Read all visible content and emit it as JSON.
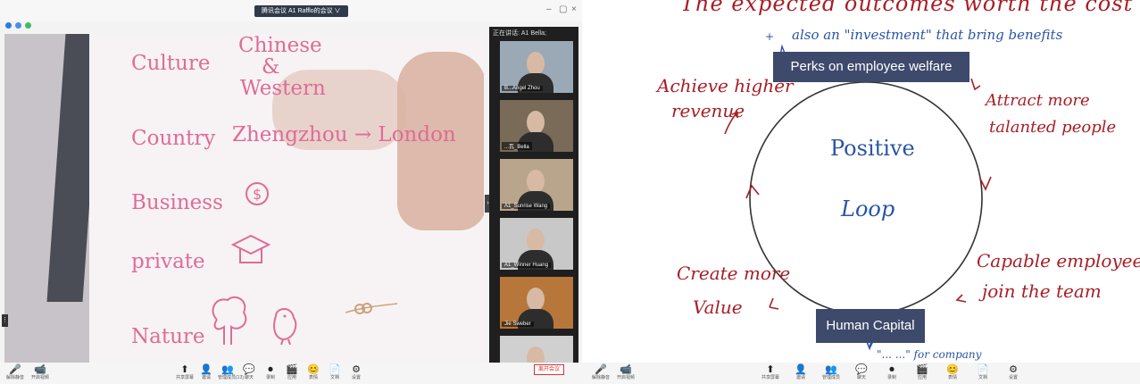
{
  "left": {
    "window_title": "腾讯会议 A1 Rafflo的会议  ∨",
    "window_controls": [
      "–",
      "▢",
      "×"
    ],
    "strip_header": "正在讲话: A1 Bella;",
    "handwriting": {
      "culture_label": "Culture",
      "culture_value_1": "Chinese",
      "culture_value_2": "&",
      "culture_value_3": "Western",
      "country_label": "Country",
      "country_value": "Zhengzhou → London",
      "business_label": "Business",
      "private_label": "private",
      "nature_label": "Nature"
    },
    "participants": [
      {
        "name": "B...Angel Zhou",
        "bg": "#9aa9b5"
      },
      {
        "name": "...瓦_Bella",
        "bg": "#7a6a58"
      },
      {
        "name": "A1_Sunrise Wang",
        "bg": "#b9a58c"
      },
      {
        "name": "A1_Winner Huang",
        "bg": "#c8c8c8"
      },
      {
        "name": "Jie Sweber",
        "bg": "#b7773b"
      },
      {
        "name": "",
        "bg": "#d0d0d0"
      }
    ],
    "toolbar": {
      "items": [
        {
          "icon": "🎤",
          "label": "解除静音"
        },
        {
          "icon": "📹",
          "label": "开启视频"
        },
        {
          "icon": "⬆",
          "label": "共享屏幕"
        },
        {
          "icon": "👤",
          "label": "邀请"
        },
        {
          "icon": "👥",
          "label": "管理成员(13)"
        },
        {
          "icon": "💬",
          "label": "聊天"
        },
        {
          "icon": "⏺",
          "label": "录制"
        },
        {
          "icon": "🎬",
          "label": "应用"
        },
        {
          "icon": "😊",
          "label": "表情"
        },
        {
          "icon": "📄",
          "label": "文档"
        },
        {
          "icon": "⚙",
          "label": "设置"
        }
      ],
      "end_meeting_label": "离开会议"
    }
  },
  "right": {
    "slide": {
      "top_text": "The expected outcomes worth the cost",
      "top_sub_plus": "+",
      "top_sub": "also an \"investment\" that bring benefits",
      "top_box": "Perks on employee welfare",
      "bottom_box": "Human Capital",
      "center_1": "Positive",
      "center_2": "Loop",
      "left_upper_1": "Achieve higher",
      "left_upper_2": "revenue",
      "right_upper_1": "Attract more",
      "right_upper_2": "talanted people",
      "right_lower_1": "Capable employee",
      "right_lower_2": "join the team",
      "left_lower_1": "Create more",
      "left_lower_2": "Value",
      "bottom_cut": "\"... ...\" for company"
    },
    "toolbar": {
      "items": [
        {
          "icon": "🎤",
          "label": "解除静音"
        },
        {
          "icon": "📹",
          "label": "开启视频"
        },
        {
          "icon": "⬆",
          "label": "共享屏幕"
        },
        {
          "icon": "👤",
          "label": "邀请"
        },
        {
          "icon": "👥",
          "label": "管理成员"
        },
        {
          "icon": "💬",
          "label": "聊天"
        },
        {
          "icon": "⏺",
          "label": "录制"
        },
        {
          "icon": "🎬",
          "label": "应用"
        },
        {
          "icon": "😊",
          "label": "表情"
        },
        {
          "icon": "📄",
          "label": "文档"
        },
        {
          "icon": "⚙",
          "label": "设置"
        }
      ]
    }
  },
  "colors": {
    "ink_pink": "#de6c96",
    "ink_red": "#a81e26",
    "ink_blue": "#2a53a6",
    "box_navy": "#3e4a6b"
  }
}
